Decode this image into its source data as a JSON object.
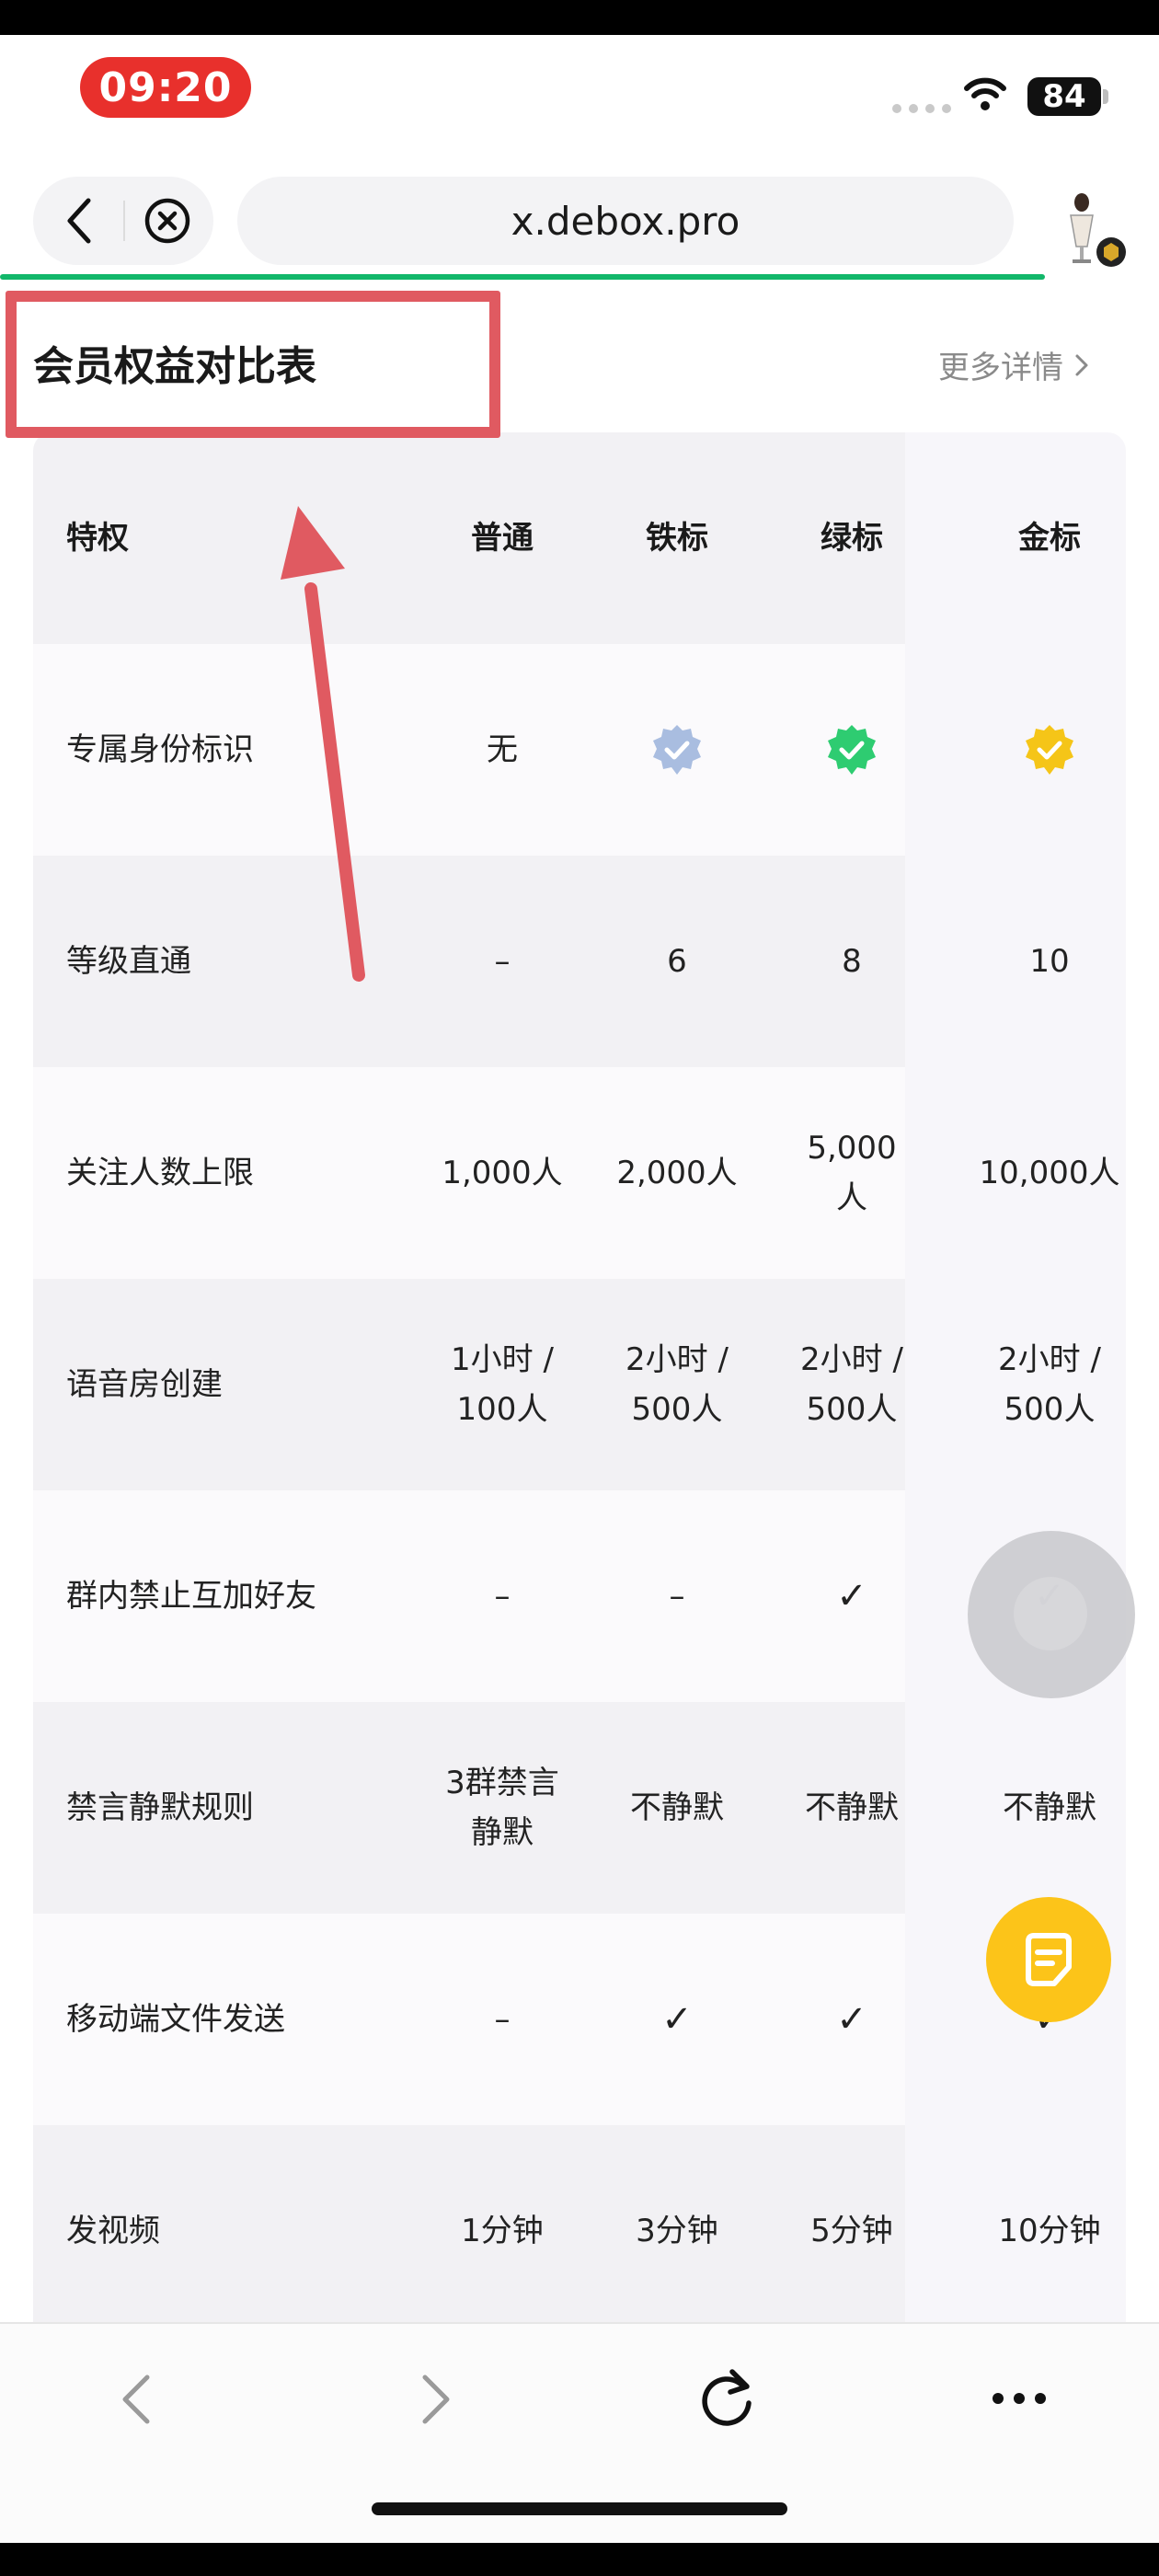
{
  "status_bar": {
    "time": "09:20",
    "battery": "84",
    "icons": [
      "signal-dots-icon",
      "wifi-icon",
      "battery-icon"
    ]
  },
  "browser": {
    "url": "x.debox.pro",
    "icons": [
      "back-icon",
      "close-icon",
      "profile-icon"
    ]
  },
  "page": {
    "title": "会员权益对比表",
    "more_details": "更多详情"
  },
  "table": {
    "headers": [
      "特权",
      "普通",
      "铁标",
      "绿标",
      "金标"
    ],
    "rows": [
      {
        "feature": "专属身份标识",
        "regular": "无",
        "iron": "",
        "green": "",
        "gold": ""
      },
      {
        "feature": "等级直通",
        "regular": "–",
        "iron": "6",
        "green": "8",
        "gold": "10"
      },
      {
        "feature": "关注人数上限",
        "regular": "1,000人",
        "iron": "2,000人",
        "green": "5,000人",
        "gold": "10,000人"
      },
      {
        "feature": "语音房创建",
        "regular": "1小时 / 100人",
        "iron": "2小时 / 500人",
        "green": "2小时 / 500人",
        "gold": "2小时 / 500人"
      },
      {
        "feature": "群内禁止互加好友",
        "regular": "–",
        "iron": "–",
        "green": "✓",
        "gold": "✓"
      },
      {
        "feature": "禁言静默规则",
        "regular": "3群禁言静默",
        "iron": "不静默",
        "green": "不静默",
        "gold": "不静默"
      },
      {
        "feature": "移动端文件发送",
        "regular": "–",
        "iron": "✓",
        "green": "✓",
        "gold": "✓"
      },
      {
        "feature": "发视频",
        "regular": "1分钟",
        "iron": "3分钟",
        "green": "5分钟",
        "gold": "10分钟"
      }
    ],
    "badge_colors": {
      "iron": "#a9bde0",
      "green": "#2ecc71",
      "gold": "#f5c518"
    }
  },
  "colors": {
    "accent_progress": "#12b76a",
    "annotation": "#e05a61",
    "fab": "#fcc419",
    "time_pill": "#e8302c"
  },
  "toolbar": {
    "icons": [
      "back-arrow-icon",
      "forward-arrow-icon",
      "reload-icon",
      "more-icon"
    ]
  }
}
